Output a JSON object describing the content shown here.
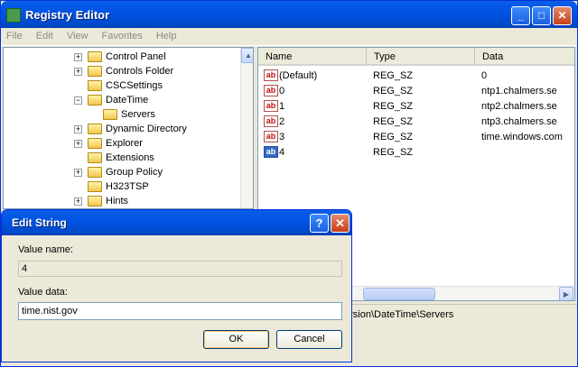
{
  "window": {
    "title": "Registry Editor",
    "minimize": "_",
    "maximize": "□",
    "close": "✕"
  },
  "menu": [
    "File",
    "Edit",
    "View",
    "Favorites",
    "Help"
  ],
  "tree": {
    "items": [
      {
        "label": "Control Panel",
        "expander": "+",
        "indent": 0
      },
      {
        "label": "Controls Folder",
        "expander": "+",
        "indent": 0
      },
      {
        "label": "CSCSettings",
        "expander": "",
        "indent": 0
      },
      {
        "label": "DateTime",
        "expander": "−",
        "indent": 0
      },
      {
        "label": "Servers",
        "expander": "",
        "indent": 1
      },
      {
        "label": "Dynamic Directory",
        "expander": "+",
        "indent": 0
      },
      {
        "label": "Explorer",
        "expander": "+",
        "indent": 0
      },
      {
        "label": "Extensions",
        "expander": "",
        "indent": 0
      },
      {
        "label": "Group Policy",
        "expander": "+",
        "indent": 0
      },
      {
        "label": "H323TSP",
        "expander": "",
        "indent": 0
      },
      {
        "label": "Hints",
        "expander": "+",
        "indent": 0
      }
    ]
  },
  "list": {
    "headers": [
      "Name",
      "Type",
      "Data"
    ],
    "rows": [
      {
        "name": "(Default)",
        "type": "REG_SZ",
        "data": "0"
      },
      {
        "name": "0",
        "type": "REG_SZ",
        "data": "ntp1.chalmers.se"
      },
      {
        "name": "1",
        "type": "REG_SZ",
        "data": "ntp2.chalmers.se"
      },
      {
        "name": "2",
        "type": "REG_SZ",
        "data": "ntp3.chalmers.se"
      },
      {
        "name": "3",
        "type": "REG_SZ",
        "data": "time.windows.com"
      },
      {
        "name": "4",
        "type": "REG_SZ",
        "data": ""
      }
    ]
  },
  "status": {
    "path": "ersion\\DateTime\\Servers"
  },
  "dialog": {
    "title": "Edit String",
    "help": "?",
    "close": "✕",
    "value_name_label": "Value name:",
    "value_name": "4",
    "value_data_label": "Value data:",
    "value_data": "time.nist.gov",
    "ok": "OK",
    "cancel": "Cancel"
  }
}
